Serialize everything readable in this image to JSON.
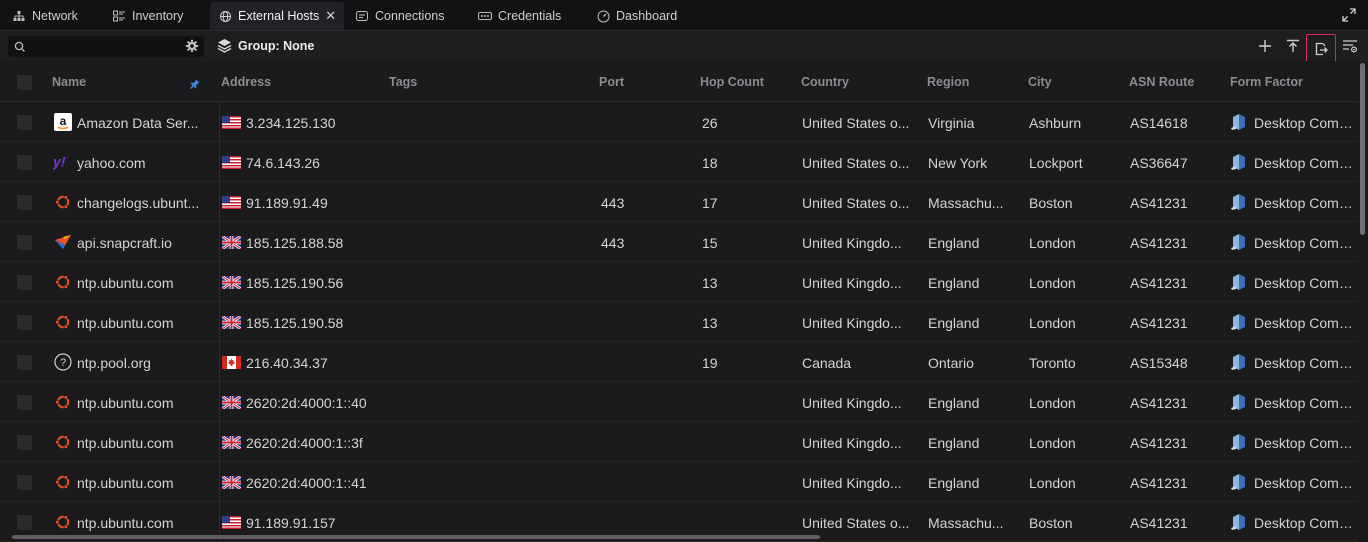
{
  "tabs": [
    {
      "label": "Network",
      "icon": "network-icon"
    },
    {
      "label": "Inventory",
      "icon": "inventory-icon"
    },
    {
      "label": "External Hosts",
      "icon": "external-hosts-icon",
      "active": true
    },
    {
      "label": "Connections",
      "icon": "connections-icon"
    },
    {
      "label": "Credentials",
      "icon": "credentials-icon"
    },
    {
      "label": "Dashboard",
      "icon": "dashboard-icon"
    }
  ],
  "toolbar": {
    "search_value": "",
    "group_label": "Group: None",
    "buttons": [
      "add-icon",
      "collapse-top-icon",
      "export-icon",
      "filter-settings-icon"
    ]
  },
  "columns": [
    "Name",
    "Address",
    "Tags",
    "Port",
    "Hop Count",
    "Country",
    "Region",
    "City",
    "ASN Route",
    "Form Factor"
  ],
  "rows": [
    {
      "icon": "amazon-logo-icon",
      "name": "Amazon Data Ser...",
      "flag": "us-flag-icon",
      "address": "3.234.125.130",
      "port": "",
      "hop": "26",
      "country": "United States o...",
      "region": "Virginia",
      "city": "Ashburn",
      "asn": "AS14618",
      "form": "Desktop Comput"
    },
    {
      "icon": "yahoo-logo-icon",
      "name": "yahoo.com",
      "flag": "us-flag-icon",
      "address": "74.6.143.26",
      "port": "",
      "hop": "18",
      "country": "United States o...",
      "region": "New York",
      "city": "Lockport",
      "asn": "AS36647",
      "form": "Desktop Comput"
    },
    {
      "icon": "ubuntu-logo-icon",
      "name": "changelogs.ubunt...",
      "flag": "us-flag-icon",
      "address": "91.189.91.49",
      "port": "443",
      "hop": "17",
      "country": "United States o...",
      "region": "Massachu...",
      "city": "Boston",
      "asn": "AS41231",
      "form": "Desktop Comput"
    },
    {
      "icon": "snapcraft-logo-icon",
      "name": "api.snapcraft.io",
      "flag": "uk-flag-icon",
      "address": "185.125.188.58",
      "port": "443",
      "hop": "15",
      "country": "United Kingdo...",
      "region": "England",
      "city": "London",
      "asn": "AS41231",
      "form": "Desktop Comput"
    },
    {
      "icon": "ubuntu-logo-icon",
      "name": "ntp.ubuntu.com",
      "flag": "uk-flag-icon",
      "address": "185.125.190.56",
      "port": "",
      "hop": "13",
      "country": "United Kingdo...",
      "region": "England",
      "city": "London",
      "asn": "AS41231",
      "form": "Desktop Comput"
    },
    {
      "icon": "ubuntu-logo-icon",
      "name": "ntp.ubuntu.com",
      "flag": "uk-flag-icon",
      "address": "185.125.190.58",
      "port": "",
      "hop": "13",
      "country": "United Kingdo...",
      "region": "England",
      "city": "London",
      "asn": "AS41231",
      "form": "Desktop Comput"
    },
    {
      "icon": "unknown-question-icon",
      "name": "ntp.pool.org",
      "flag": "ca-flag-icon",
      "address": "216.40.34.37",
      "port": "",
      "hop": "19",
      "country": "Canada",
      "region": "Ontario",
      "city": "Toronto",
      "asn": "AS15348",
      "form": "Desktop Comput"
    },
    {
      "icon": "ubuntu-logo-icon",
      "name": "ntp.ubuntu.com",
      "flag": "uk-flag-icon",
      "address": "2620:2d:4000:1::40",
      "port": "",
      "hop": "",
      "country": "United Kingdo...",
      "region": "England",
      "city": "London",
      "asn": "AS41231",
      "form": "Desktop Comput"
    },
    {
      "icon": "ubuntu-logo-icon",
      "name": "ntp.ubuntu.com",
      "flag": "uk-flag-icon",
      "address": "2620:2d:4000:1::3f",
      "port": "",
      "hop": "",
      "country": "United Kingdo...",
      "region": "England",
      "city": "London",
      "asn": "AS41231",
      "form": "Desktop Comput"
    },
    {
      "icon": "ubuntu-logo-icon",
      "name": "ntp.ubuntu.com",
      "flag": "uk-flag-icon",
      "address": "2620:2d:4000:1::41",
      "port": "",
      "hop": "",
      "country": "United Kingdo...",
      "region": "England",
      "city": "London",
      "asn": "AS41231",
      "form": "Desktop Comput"
    },
    {
      "icon": "ubuntu-logo-icon",
      "name": "ntp.ubuntu.com",
      "flag": "us-flag-icon",
      "address": "91.189.91.157",
      "port": "",
      "hop": "",
      "country": "United States o...",
      "region": "Massachu...",
      "city": "Boston",
      "asn": "AS41231",
      "form": "Desktop Comput"
    }
  ]
}
